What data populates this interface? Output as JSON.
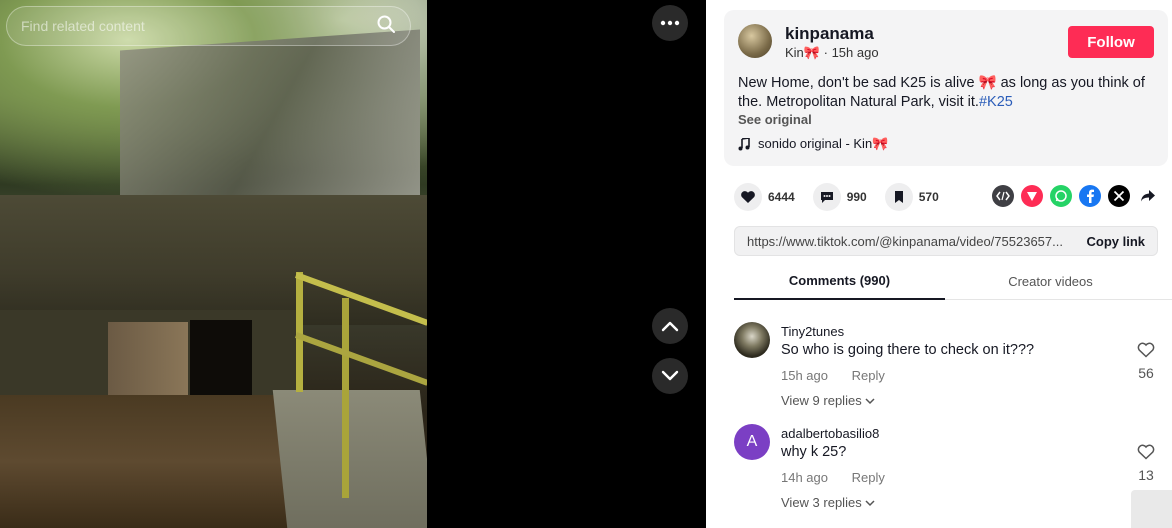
{
  "search": {
    "placeholder": "Find related content"
  },
  "video_controls": {
    "more_icon": "more-horizontal-icon",
    "up_icon": "chevron-up-icon",
    "down_icon": "chevron-down-icon"
  },
  "author": {
    "username": "kinpanama",
    "display_name": "Kin🎀",
    "time_ago": "15h ago",
    "follow_label": "Follow"
  },
  "caption": {
    "text": "New Home, don't be sad K25 is alive 🎀 as long as you think of the. Metropolitan Natural Park, visit it.",
    "hashtag": "#K25",
    "see_original": "See original"
  },
  "music": {
    "label": "sonido original - Kin🎀"
  },
  "actions": {
    "likes": "6444",
    "comments": "990",
    "saves": "570"
  },
  "share_icons": [
    "embed-icon",
    "tiktok-send-icon",
    "whatsapp-icon",
    "facebook-icon",
    "x-icon",
    "share-arrow-icon"
  ],
  "link": {
    "url": "https://www.tiktok.com/@kinpanama/video/75523657...",
    "copy_label": "Copy link"
  },
  "tabs": {
    "comments": "Comments (990)",
    "creator": "Creator videos"
  },
  "comments": [
    {
      "username": "Tiny2tunes",
      "text": "So who is going there to check on it???",
      "time": "15h ago",
      "reply_label": "Reply",
      "likes": "56",
      "view_replies": "View 9 replies"
    },
    {
      "username": "adalbertobasilio8",
      "avatar_letter": "A",
      "text": "why k 25?",
      "time": "14h ago",
      "reply_label": "Reply",
      "likes": "13",
      "view_replies": "View 3 replies"
    }
  ],
  "colors": {
    "accent": "#fe2c55",
    "hashtag": "#2b5db9"
  }
}
